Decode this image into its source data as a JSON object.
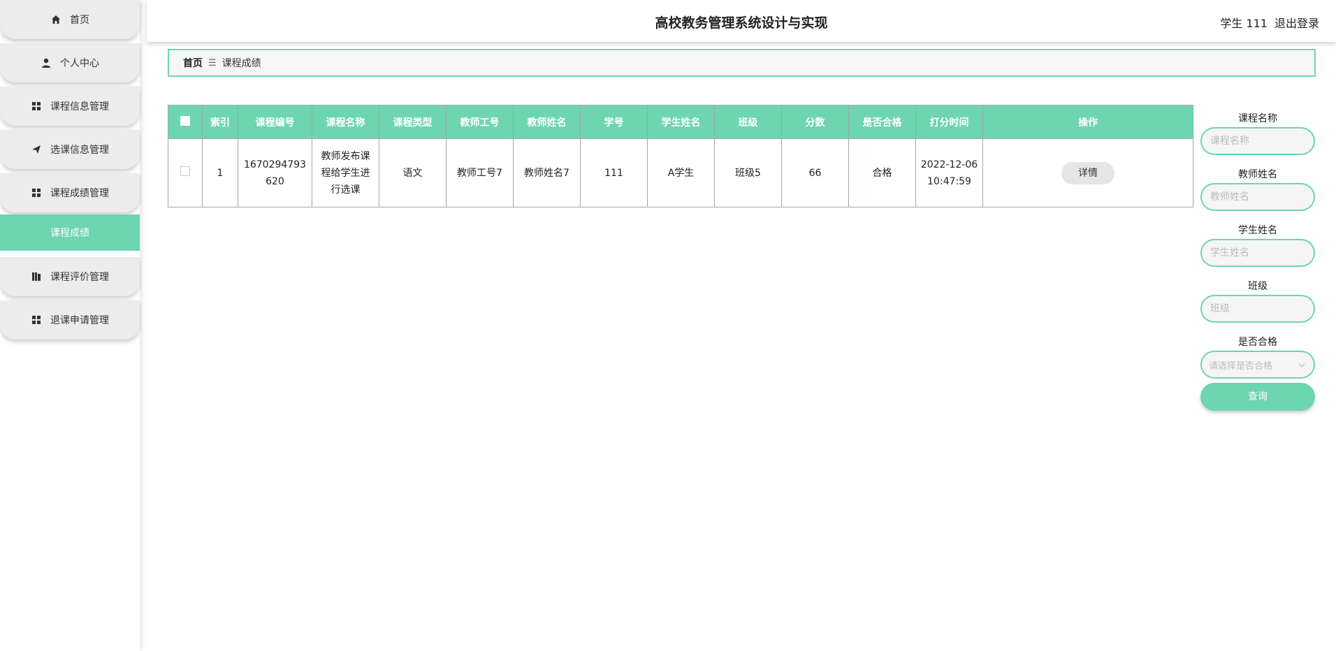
{
  "header": {
    "title": "高校教务管理系统设计与实现",
    "user": "学生 111",
    "logout": "退出登录"
  },
  "sidebar": {
    "items": [
      {
        "label": "首页",
        "icon": "home-icon"
      },
      {
        "label": "个人中心",
        "icon": "user-icon"
      },
      {
        "label": "课程信息管理",
        "icon": "grid-icon"
      },
      {
        "label": "选课信息管理",
        "icon": "send-icon"
      },
      {
        "label": "课程成绩管理",
        "icon": "grid-icon"
      },
      {
        "label": "课程评价管理",
        "icon": "book-icon"
      },
      {
        "label": "退课申请管理",
        "icon": "grid-icon"
      }
    ],
    "active_sub": "课程成绩"
  },
  "breadcrumb": {
    "home": "首页",
    "separator": "☰",
    "current": "课程成绩"
  },
  "table": {
    "headers": [
      "索引",
      "课程编号",
      "课程名称",
      "课程类型",
      "教师工号",
      "教师姓名",
      "学号",
      "学生姓名",
      "班级",
      "分数",
      "是否合格",
      "打分时间",
      "操作"
    ],
    "rows": [
      {
        "index": "1",
        "course_no": "1670294793620",
        "course_name": "教师发布课程给学生进行选课",
        "course_type": "语文",
        "teacher_no": "教师工号7",
        "teacher_name": "教师姓名7",
        "student_no": "111",
        "student_name": "A学生",
        "class": "班级5",
        "score": "66",
        "pass": "合格",
        "time": "2022-12-06 10:47:59",
        "action": "详情"
      }
    ]
  },
  "search": {
    "course_name_label": "课程名称",
    "course_name_placeholder": "课程名称",
    "teacher_name_label": "教师姓名",
    "teacher_name_placeholder": "教师姓名",
    "student_name_label": "学生姓名",
    "student_name_placeholder": "学生姓名",
    "class_label": "班级",
    "class_placeholder": "班级",
    "pass_label": "是否合格",
    "pass_placeholder": "请选择是否合格",
    "button": "查询"
  },
  "colors": {
    "accent": "#6dd5b0"
  }
}
